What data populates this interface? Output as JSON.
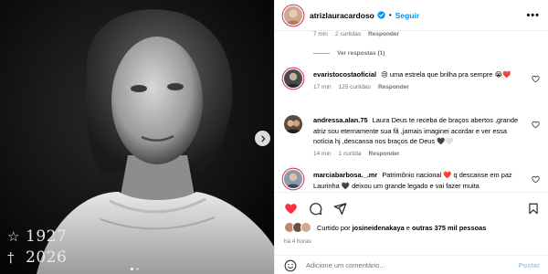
{
  "media": {
    "birth_symbol": "☆",
    "birth_year": "1927",
    "death_symbol": "†",
    "death_year": "2026",
    "carousel_count": 2,
    "carousel_active": 1
  },
  "header": {
    "username": "atrizlauracardoso",
    "separator": "•",
    "follow_label": "Seguir",
    "more_label": "•••"
  },
  "top_meta": {
    "time": "7 min",
    "likes": "2 curtidas",
    "reply": "Responder"
  },
  "see_replies": "Ver respostas (1)",
  "comments": [
    {
      "username": "evaristocostaoficial",
      "text": "😢 uma estrela que brilha pra sempre 😭❤️",
      "time": "17 min",
      "likes": "125 curtidas",
      "reply": "Responder"
    },
    {
      "username": "andressa.alan.75",
      "text": "Laura Deus te receba de braços abertos ,grande atriz sou eternamente sua fã ,jamais imaginei acordar e ver essa notícia hj ,descansa nos braços de Deus 🖤🤍",
      "time": "14 min",
      "likes": "1 curtida",
      "reply": "Responder"
    },
    {
      "username": "marciabarbosa._.mr",
      "text": "Patrimônio nacional ❤️ q descanse em paz Laurinha 🖤 deixou um grande legado e vai fazer muita",
      "time": "",
      "likes": "",
      "reply": ""
    }
  ],
  "likes_line": {
    "prefix": "Curtido por",
    "user": "josineidenakaya",
    "middle": "e",
    "others": "outras 375 mil pessoas"
  },
  "time_ago": "há 4 horas",
  "comment_input": {
    "placeholder": "Adicione um comentário...",
    "value": ""
  },
  "post_label": "Postar",
  "colors": {
    "accent": "#0095f6",
    "like_red": "#ff3040",
    "muted": "#737373"
  }
}
